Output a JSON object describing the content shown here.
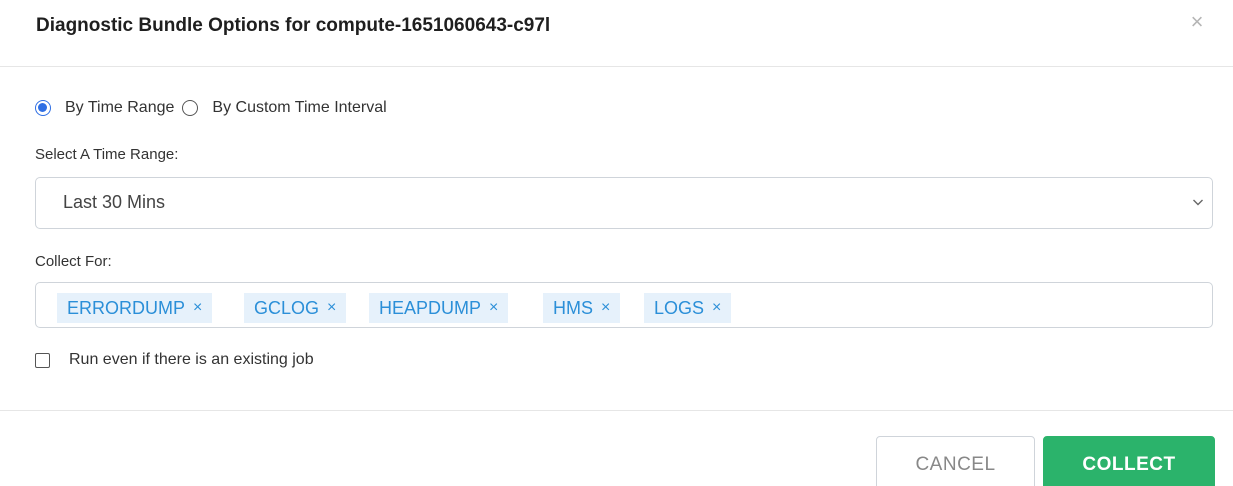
{
  "dialog": {
    "title": "Diagnostic Bundle Options for compute-1651060643-c97l",
    "close_glyph": "×"
  },
  "range_mode": {
    "options": [
      {
        "label": "By Time Range",
        "selected": true
      },
      {
        "label": "By Custom Time Interval",
        "selected": false
      }
    ]
  },
  "time_range": {
    "label": "Select A Time Range:",
    "selected_value": "Last 30 Mins"
  },
  "collect_for": {
    "label": "Collect For:",
    "tags": [
      "ERRORDUMP",
      "GCLOG",
      "HEAPDUMP",
      "HMS",
      "LOGS"
    ],
    "remove_glyph": "×"
  },
  "run_existing": {
    "label": "Run even if there is an existing job",
    "checked": false
  },
  "footer": {
    "cancel_label": "CANCEL",
    "collect_label": "COLLECT"
  },
  "colors": {
    "accent_blue": "#2f6fe4",
    "tag_text": "#2b8fd8",
    "tag_bg": "#e6f1fb",
    "collect_green": "#2bb36b"
  },
  "icons": {
    "close": "close-icon",
    "select": "chevron-down-icon"
  }
}
